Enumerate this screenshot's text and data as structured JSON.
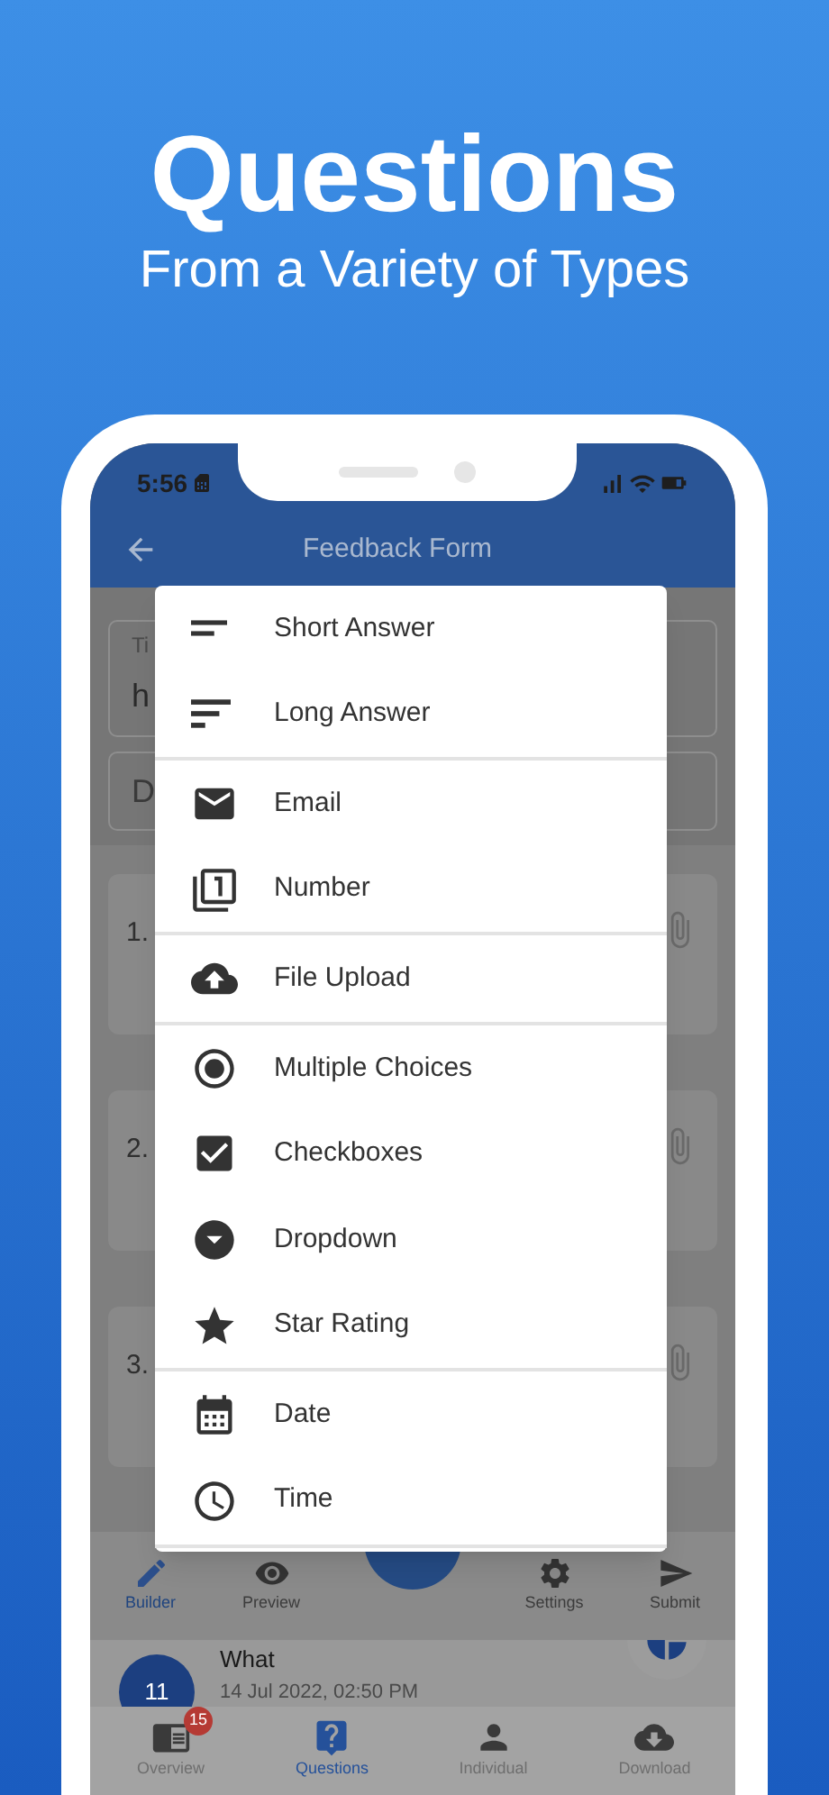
{
  "hero": {
    "title": "Questions",
    "subtitle": "From a Variety of Types"
  },
  "status_bar": {
    "time": "5:56"
  },
  "header": {
    "title": "Feedback Form"
  },
  "form": {
    "title_field": {
      "label": "Ti",
      "value": "h"
    },
    "description_field": {
      "placeholder": "D"
    }
  },
  "questions": [
    {
      "number": "1."
    },
    {
      "number": "2."
    },
    {
      "number": "3."
    }
  ],
  "type_menu": {
    "groups": [
      {
        "items": [
          {
            "label": "Short Answer",
            "kind": "short"
          },
          {
            "label": "Long Answer",
            "kind": "long"
          }
        ]
      },
      {
        "items": [
          {
            "label": "Email",
            "kind": "email"
          },
          {
            "label": "Number",
            "kind": "number"
          }
        ]
      },
      {
        "items": [
          {
            "label": "File Upload",
            "kind": "upload"
          }
        ]
      },
      {
        "items": [
          {
            "label": "Multiple Choices",
            "kind": "radio"
          },
          {
            "label": "Checkboxes",
            "kind": "checkbox"
          },
          {
            "label": "Dropdown",
            "kind": "dropdown"
          },
          {
            "label": "Star Rating",
            "kind": "star"
          }
        ]
      },
      {
        "items": [
          {
            "label": "Date",
            "kind": "date"
          },
          {
            "label": "Time",
            "kind": "time"
          }
        ]
      }
    ]
  },
  "toolbar": [
    {
      "label": "Builder",
      "kind": "builder",
      "selected": true
    },
    {
      "label": "Preview",
      "kind": "preview",
      "selected": false
    },
    {
      "label": "Settings",
      "kind": "settings",
      "selected": false
    },
    {
      "label": "Submit",
      "kind": "submit",
      "selected": false
    }
  ],
  "response": {
    "count": "11",
    "title": "What",
    "date": "14 Jul 2022, 02:50 PM"
  },
  "bottom_nav": [
    {
      "label": "Overview",
      "kind": "overview",
      "badge": "15",
      "selected": false
    },
    {
      "label": "Questions",
      "kind": "questions",
      "selected": true
    },
    {
      "label": "Individual",
      "kind": "person",
      "selected": false
    },
    {
      "label": "Download",
      "kind": "download",
      "selected": false
    }
  ]
}
